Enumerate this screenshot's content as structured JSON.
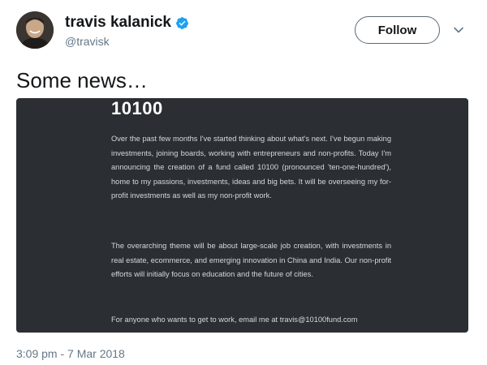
{
  "user": {
    "display_name": "travis kalanick",
    "handle": "@travisk",
    "verified": true,
    "verified_color": "#1da1f2"
  },
  "actions": {
    "follow_label": "Follow",
    "menu_icon": "chevron-down-icon"
  },
  "tweet": {
    "text": "Some news…",
    "timestamp": "3:09 pm - 7 Mar 2018"
  },
  "media": {
    "background": "#2b2f33",
    "title": "10100",
    "paragraphs": [
      "Over the past few months I've started thinking about what's next. I've begun making investments, joining boards, working with entrepreneurs and non-profits. Today I'm announcing the creation of a fund called 10100 (pronounced 'ten-one-hundred'), home to my passions, investments, ideas and big bets. It will be overseeing my for-profit investments as well as my non-profit work.",
      "The overarching theme will be about large-scale job creation, with investments in real estate, ecommerce, and emerging innovation in China and India. Our non-profit efforts will initially focus on education and the future of cities.",
      "For anyone who wants to get to work, email me at travis@10100fund.com"
    ]
  }
}
